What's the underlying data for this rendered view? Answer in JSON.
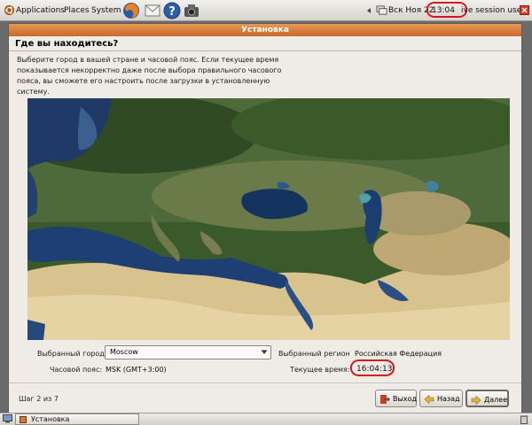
{
  "top_panel": {
    "menus": {
      "applications": "Applications",
      "places": "Places",
      "system": "System"
    },
    "date": "Вск Ноя 22",
    "clock": "13:04",
    "session": "ive session user",
    "icons": [
      "ubuntu-logo-icon",
      "firefox-icon",
      "mail-icon",
      "help-icon",
      "camera-icon",
      "network-icon",
      "session-icon"
    ]
  },
  "window": {
    "title": "Установка",
    "heading": "Где вы находитесь?",
    "description": "Выберите город в вашей стране и часовой пояс. Если текущее время показывается некорректно даже после выбора правильного часового пояса, вы сможете его настроить после загрузки в установленную систему.",
    "fields": {
      "city_label": "Выбранный город:",
      "city_value": "Moscow",
      "region_label": "Выбранный регион",
      "region_value": "Российская Федерация",
      "timezone_label": "Часовой пояс:",
      "timezone_value": "MSK (GMT+3:00)",
      "time_label": "Текущее время:",
      "time_value": "16:04:13"
    },
    "step": "Шаг 2 из 7",
    "buttons": {
      "quit": "Выход",
      "back": "Назад",
      "next": "Далее"
    }
  },
  "bottom_panel": {
    "task_label": "Установка"
  },
  "colors": {
    "highlight": "#d9161f",
    "titlebar": "#d27a3a"
  }
}
